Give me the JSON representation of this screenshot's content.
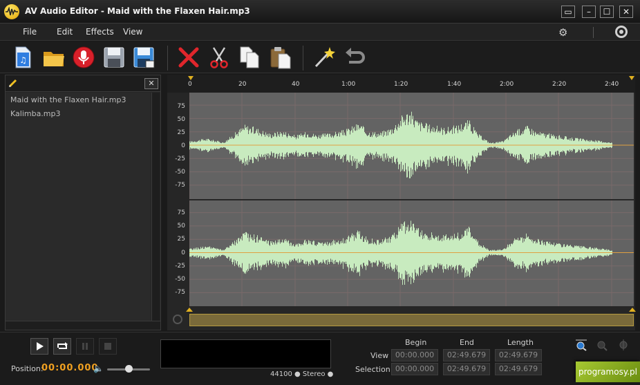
{
  "window": {
    "title": "AV Audio Editor - Maid with the Flaxen Hair.mp3",
    "buttons": {
      "restore": "▭",
      "minimize": "–",
      "maximize": "☐",
      "close": "✕"
    }
  },
  "menu": [
    "File",
    "Edit",
    "Effects",
    "View"
  ],
  "toolbar": {
    "tools": [
      "new-file",
      "open-folder",
      "record",
      "save",
      "save-as",
      "delete",
      "cut",
      "copy",
      "paste",
      "magic-wand",
      "undo"
    ]
  },
  "files": {
    "close_label": "✕",
    "items": [
      "Maid with the Flaxen Hair.mp3",
      "Kalimba.mp3"
    ]
  },
  "ruler": {
    "labels": [
      "0",
      "20",
      "40",
      "1:00",
      "1:20",
      "1:40",
      "2:00",
      "2:20",
      "2:40"
    ]
  },
  "channels": {
    "y_labels": [
      "75",
      "50",
      "25",
      "0",
      "-25",
      "-50",
      "-75"
    ]
  },
  "transport": {
    "position_label": "Position:",
    "position_value": "00:00.000",
    "format": "44100 ● Stereo ●"
  },
  "timecodes": {
    "headers": [
      "Begin",
      "End",
      "Length"
    ],
    "view_label": "View",
    "selection_label": "Selection",
    "view": [
      "00:00.000",
      "02:49.679",
      "02:49.679"
    ],
    "selection": [
      "00:00.000",
      "02:49.679",
      "02:49.679"
    ]
  },
  "watermark": "programosy.pl",
  "colors": {
    "waveform": "#c8ebbf",
    "selection": "#636363",
    "timecode_accent": "#f0a020"
  }
}
